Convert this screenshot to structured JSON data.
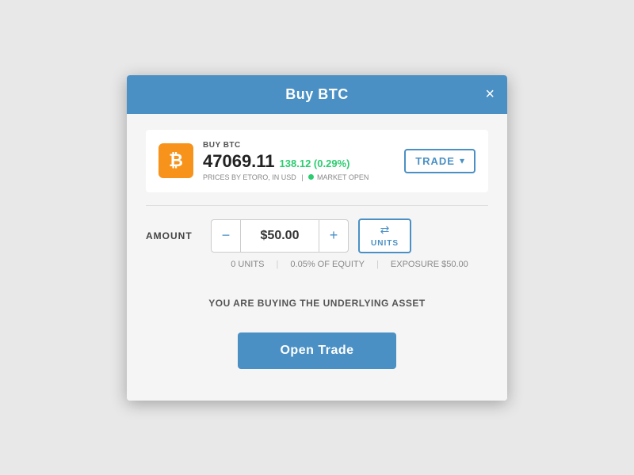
{
  "modal": {
    "title": "Buy BTC",
    "close_label": "×"
  },
  "asset": {
    "icon": "₿",
    "buy_label": "BUY BTC",
    "price": "47069.11",
    "change": "138.12 (0.29%)",
    "meta_provider": "PRICES BY ETORO, IN USD",
    "market_status": "MARKET OPEN"
  },
  "trade_dropdown": {
    "label": "TRADE",
    "arrow": "▾"
  },
  "amount": {
    "label": "AMOUNT",
    "minus_label": "−",
    "value": "$50.00",
    "plus_label": "+",
    "units_icon": "⇄",
    "units_label": "UNITS"
  },
  "amount_meta": {
    "units": "0 UNITS",
    "equity": "0.05% OF EQUITY",
    "exposure": "EXPOSURE $50.00",
    "sep1": "|",
    "sep2": "|"
  },
  "underlying_msg": "YOU ARE BUYING THE UNDERLYING ASSET",
  "open_trade_btn": "Open Trade"
}
